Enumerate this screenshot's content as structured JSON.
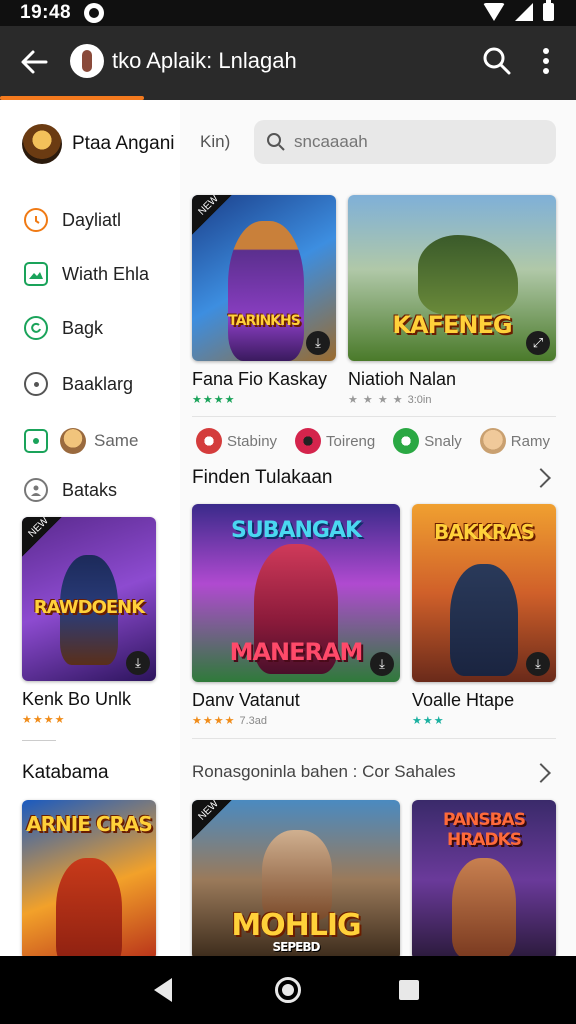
{
  "status": {
    "time": "19:48"
  },
  "appbar": {
    "title": "tko Aplaik: Lnlagah",
    "back_icon": "arrow-left-icon",
    "search_icon": "search-icon",
    "more_icon": "more-vert-icon",
    "progress": 0.25
  },
  "sidebar": {
    "profile_name": "Ptaa Angani",
    "items": [
      {
        "label": "Dayliatl",
        "icon": "clock-icon",
        "color": "#f07a14"
      },
      {
        "label": "Wiath Ehla",
        "icon": "image-icon",
        "color": "#1aa35a"
      },
      {
        "label": "Bagk",
        "icon": "refresh-icon",
        "color": "#1aa35a"
      },
      {
        "label": "Baaklarg",
        "icon": "circle-dot-icon",
        "color": "#555555"
      },
      {
        "label": "Same",
        "icon": "avatar-icon",
        "color": "#1aa35a"
      },
      {
        "label": "Bataks",
        "icon": "person-circle-icon",
        "color": "#777777"
      }
    ],
    "featured": {
      "art_title": "RAWDOENK",
      "tag": "NEW",
      "title": "Kenk Bo Unlk",
      "stars": "★★★★"
    },
    "section_title": "Katabama",
    "bottom_art_title": "ARNIE CRAS"
  },
  "main": {
    "kin_label": "Kin)",
    "search": {
      "placeholder": "sncaaaah"
    },
    "top_cards": [
      {
        "art_title": "TARINKHS",
        "tag": "NEW",
        "title": "Fana Fio Kaskay",
        "stars": "★★★★",
        "meta": ""
      },
      {
        "art_title": "KAFENEG",
        "tag": "",
        "title": "Niatioh Nalan",
        "stars": "★ ★ ★ ★",
        "meta": "3:0in"
      }
    ],
    "chips": [
      {
        "label": "Stabiny",
        "icon": "sword-icon",
        "color": "#d43c3c"
      },
      {
        "label": "Toireng",
        "icon": "mask-icon",
        "color": "#d4244c"
      },
      {
        "label": "Snaly",
        "icon": "leaf-icon",
        "color": "#2aa843"
      },
      {
        "label": "Ramy",
        "icon": "face-icon",
        "color": "#c9a070"
      }
    ],
    "section1": {
      "title": "Finden Tulakaan"
    },
    "row2": [
      {
        "art_title": "MANERAM",
        "banner": "SUBANGAK",
        "title": "Danv Vatanut",
        "stars": "★★★★",
        "meta": "7.3ad"
      },
      {
        "art_title": "BAKKRAS",
        "banner": "",
        "title": "Voalle Htape",
        "stars": "★★★",
        "meta": ""
      }
    ],
    "section2": {
      "title": "Ronasgoninla bahen : Cor Sahales"
    },
    "row3": [
      {
        "art_title": "MOHLIG",
        "subtitle": "SEPEBD",
        "tag": "NEW"
      },
      {
        "art_title": "PANSBAS HRADKS"
      }
    ]
  },
  "colors": {
    "accent": "#f47a1e",
    "appbar": "#2a2a2a",
    "rating_green": "#1aa35a",
    "rating_orange": "#f08c1a"
  }
}
